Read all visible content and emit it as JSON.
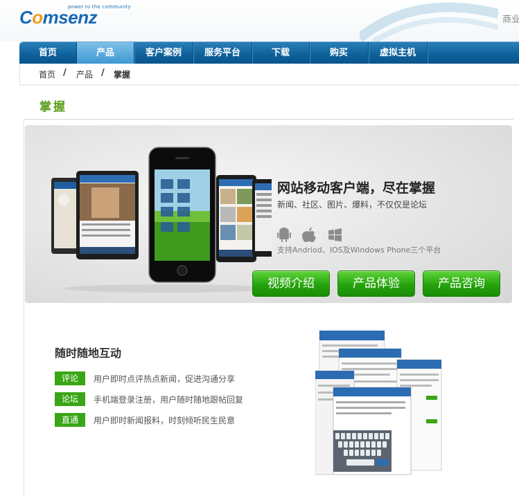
{
  "header": {
    "logo_text_a": "C",
    "logo_text_o": "o",
    "logo_text_rest": "msenz",
    "logo_tagline": "power to the community",
    "top_right_link": "商业"
  },
  "nav": {
    "items": [
      {
        "label": "首页"
      },
      {
        "label": "产品"
      },
      {
        "label": "客户案例"
      },
      {
        "label": "服务平台"
      },
      {
        "label": "下载"
      },
      {
        "label": "购买"
      },
      {
        "label": "虚拟主机"
      }
    ],
    "active_index": 1
  },
  "breadcrumb": {
    "items": [
      "首页",
      "产品",
      "掌握"
    ],
    "separator": "/"
  },
  "section": {
    "title": "掌握"
  },
  "banner": {
    "title": "网站移动客户端，尽在掌握",
    "subtitle": "新闻、社区、图片、爆料，不仅仅是论坛",
    "platforms_text": "支持Andriod、IOS及Windows Phone三个平台",
    "platform_icons": [
      "android-icon",
      "apple-icon",
      "windows-icon"
    ],
    "buttons": [
      "视频介绍",
      "产品体验",
      "产品咨询"
    ]
  },
  "features": {
    "title": "随时随地互动",
    "rows": [
      {
        "tag": "评论",
        "desc": "用户即时点评热点新闻，促进沟通分享"
      },
      {
        "tag": "论坛",
        "desc": "手机端登录注册，用户随时随地跟帖回复"
      },
      {
        "tag": "直通车",
        "desc": "用户即时新闻报料，时刻倾听民生民意"
      }
    ]
  },
  "colors": {
    "nav_bg": "#0d5f99",
    "nav_active": "#4ea6dd",
    "accent_green": "#3aa617",
    "title_green": "#5a9e1c",
    "logo_blue": "#1669b6",
    "logo_orange": "#f39a1c"
  }
}
